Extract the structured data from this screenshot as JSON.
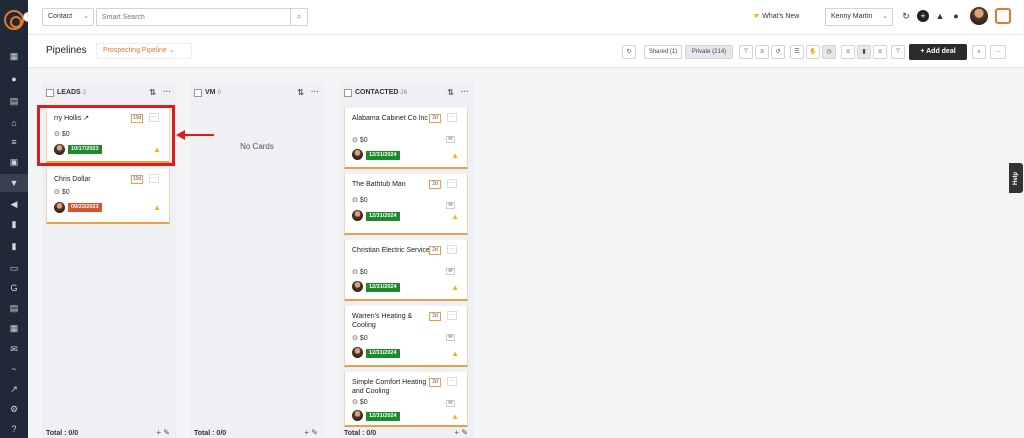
{
  "topbar": {
    "contact_select": "Contact",
    "search_placeholder": "Smart Search",
    "whats_new": "What's New",
    "user_select": "Kenny Martin"
  },
  "subheader": {
    "title": "Pipelines",
    "pipeline_select": "Prospecting Pipeline",
    "shared": "Shared (1)",
    "private": "Private (214)",
    "add_deal": "Add deal"
  },
  "colors": {
    "accent": "#e8762d",
    "sidebar": "#1f2937",
    "highlight": "#e01b1b",
    "date_green": "#1e8a2b",
    "date_red": "#d6552f",
    "warning": "#f2b705"
  },
  "columns": [
    {
      "name": "LEADS",
      "count": "2",
      "total": "Total : 0/0",
      "cards": [
        {
          "title": "rry Hollis",
          "badge": "10d",
          "amount": "$0",
          "date": "10/17/2023",
          "date_color": "green"
        },
        {
          "title": "Chris Dollar",
          "badge": "10d",
          "amount": "$0",
          "date": "09/23/2023",
          "date_color": "red"
        }
      ]
    },
    {
      "name": "VM",
      "count": "0",
      "total": "Total : 0/0",
      "empty_text": "No Cards",
      "cards": []
    },
    {
      "name": "CONTACTED",
      "count": "26",
      "total": "Total : 0/0",
      "cards": [
        {
          "title": "Alabama Cabinet Co Inc",
          "badge": "2d",
          "amount": "$0",
          "date": "12/31/2024",
          "date_color": "green"
        },
        {
          "title": "The Bathtub Man",
          "badge": "2d",
          "amount": "$0",
          "date": "12/31/2024",
          "date_color": "green"
        },
        {
          "title": "Christian Electric Service",
          "badge": "2d",
          "amount": "$0",
          "date": "12/31/2024",
          "date_color": "green"
        },
        {
          "title": "Warren's Heating & Cooling",
          "badge": "2d",
          "amount": "$0",
          "date": "12/31/2024",
          "date_color": "green"
        },
        {
          "title": "Simple Comfort Heating and Cooling",
          "badge": "2d",
          "amount": "$0",
          "date": "12/31/2024",
          "date_color": "green"
        }
      ]
    }
  ],
  "help_tab": "Help",
  "icons": [
    "logo-icon",
    "dashboard-icon",
    "contacts-icon",
    "bank-icon",
    "list-icon",
    "image-icon",
    "filter-icon",
    "megaphone-icon",
    "document-icon",
    "chart-icon",
    "folder-icon",
    "google-icon",
    "calendar-icon",
    "mail-icon",
    "signature-icon",
    "analytics-icon",
    "settings-icon",
    "help-icon"
  ]
}
